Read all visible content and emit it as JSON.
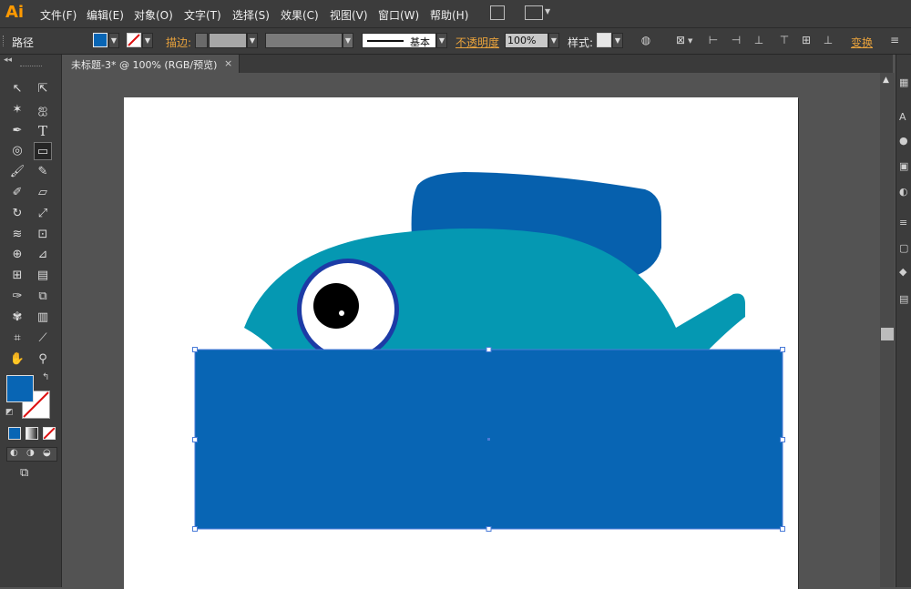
{
  "app": {
    "logo": "Ai"
  },
  "menu": [
    "文件(F)",
    "编辑(E)",
    "对象(O)",
    "文字(T)",
    "选择(S)",
    "效果(C)",
    "视图(V)",
    "窗口(W)",
    "帮助(H)"
  ],
  "control_bar": {
    "object_type": "路径",
    "stroke_label": "描边:",
    "stroke_style": "基本",
    "opacity_label": "不透明度",
    "opacity_value": "100%",
    "style_label": "样式:",
    "transform_label": "变换"
  },
  "document_tab": {
    "title": "未标题-3* @ 100% (RGB/预览)",
    "close": "×"
  },
  "colors": {
    "ui_bg": "#535353",
    "panel_bg": "#3c3c3c",
    "fill_color": "#0865b4",
    "fish_body": "#0598b2",
    "fish_fin": "#0660ad",
    "eye_ring": "#1c3ba6",
    "selection": "#4a7bd8",
    "accent_orange": "#e8a23c"
  },
  "icons": {
    "toolbar": [
      "selection-tool-icon",
      "direct-selection-tool-icon",
      "magic-wand-tool-icon",
      "lasso-tool-icon",
      "pen-tool-icon",
      "type-tool-icon",
      "spiral-tool-icon",
      "rectangle-tool-icon",
      "paintbrush-tool-icon",
      "pencil-tool-icon",
      "blob-brush-tool-icon",
      "eraser-tool-icon",
      "rotate-tool-icon",
      "scale-tool-icon",
      "warp-tool-icon",
      "free-transform-tool-icon",
      "shape-builder-tool-icon",
      "perspective-grid-tool-icon",
      "mesh-tool-icon",
      "gradient-tool-icon",
      "eyedropper-tool-icon",
      "blend-tool-icon",
      "symbol-sprayer-tool-icon",
      "column-graph-tool-icon",
      "artboard-tool-icon",
      "slice-tool-icon",
      "hand-tool-icon",
      "zoom-tool-icon"
    ]
  }
}
